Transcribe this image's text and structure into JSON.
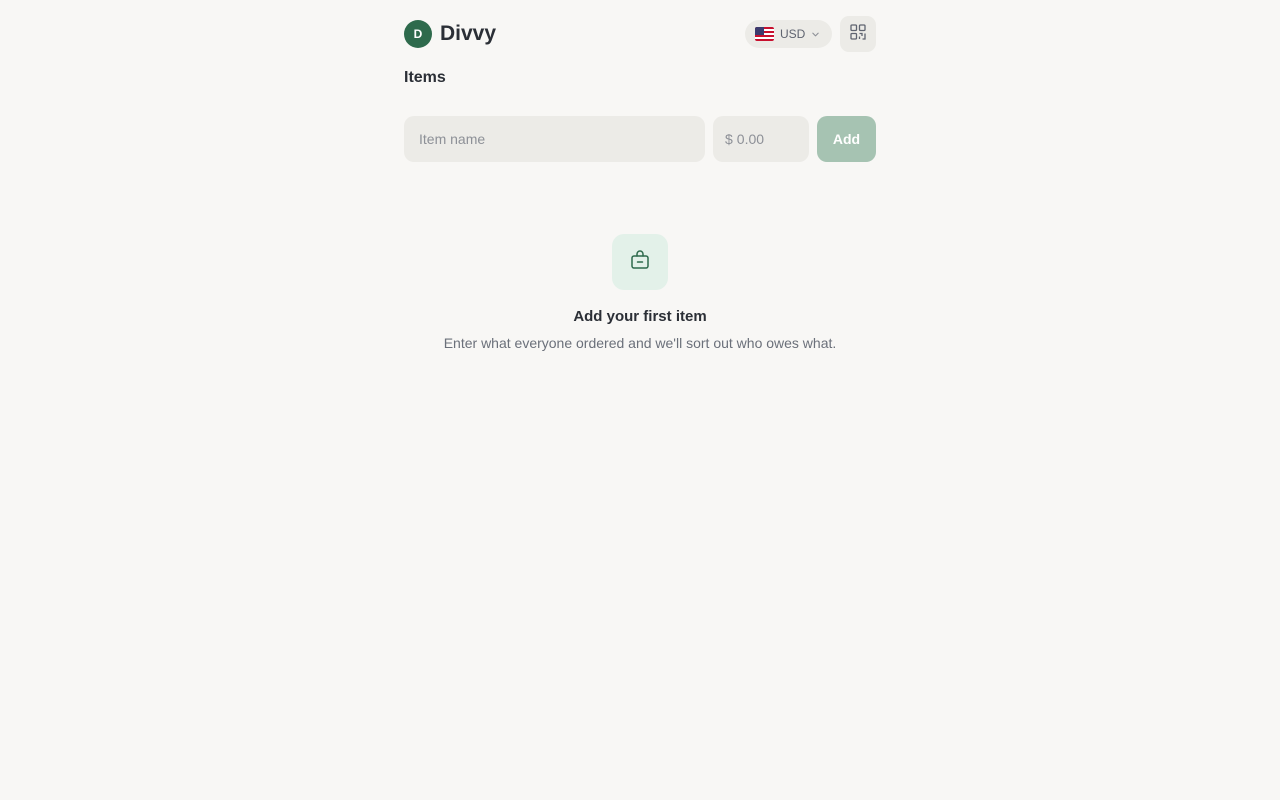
{
  "header": {
    "logo_letter": "D",
    "app_name": "Divvy",
    "currency": {
      "code": "USD",
      "flag_icon": "us-flag-icon"
    },
    "qr_icon": "qr-code-icon"
  },
  "items_section": {
    "title": "Items",
    "item_name_placeholder": "Item name",
    "price_prefix": "$",
    "price_placeholder": "0.00",
    "add_label": "Add"
  },
  "empty_state": {
    "icon": "bag-icon",
    "title": "Add your first item",
    "subtitle": "Enter what everyone ordered and we'll sort out who owes what."
  },
  "colors": {
    "brand": "#2e6a4c",
    "add_button": "#a6c3b2",
    "empty_icon_bg": "#e3f1e9",
    "background": "#f8f7f5"
  }
}
